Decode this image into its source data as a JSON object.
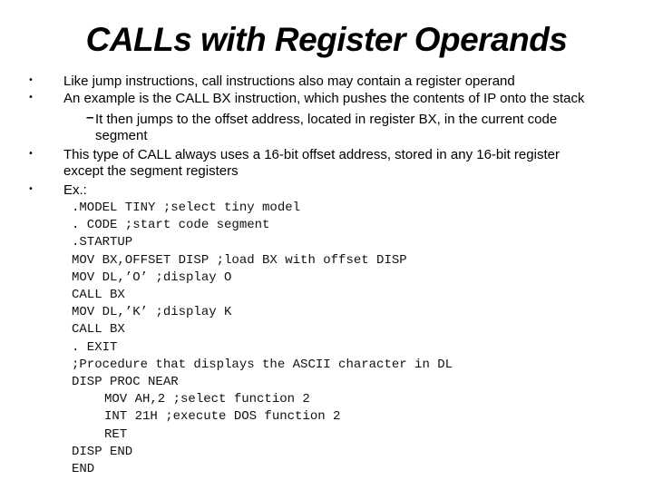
{
  "slide": {
    "title": "CALLs with Register Operands",
    "bullet_glyph": "•",
    "dash_glyph": "–",
    "bullets": [
      "Like jump instructions, call instructions also may contain a register operand",
      "An example is the CALL BX instruction, which pushes the contents of IP onto the stack",
      "This type of CALL always uses a 16-bit offset address, stored in any 16-bit register",
      "Ex.:"
    ],
    "bullet3_continuation": "except the segment registers",
    "sub_bullet": "It then jumps to the offset address, located in register BX, in the current code",
    "sub_bullet_continuation": "segment",
    "code_lines": [
      ".MODEL TINY ;select tiny model",
      ". CODE ;start code segment",
      ".STARTUP",
      "MOV BX,OFFSET DISP ;load BX with offset DISP",
      "MOV DL,’O’ ;display O",
      "CALL BX",
      "MOV DL,’K’ ;display K",
      "CALL BX",
      ". EXIT",
      ";Procedure that displays the ASCII character in DL",
      "DISP PROC NEAR",
      "MOV AH,2 ;select function 2",
      "INT 21H ;execute DOS function 2",
      "RET",
      "DISP END",
      "END"
    ]
  }
}
